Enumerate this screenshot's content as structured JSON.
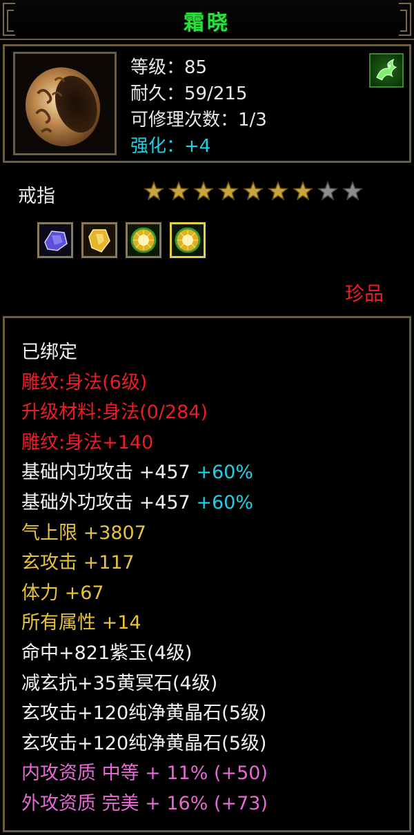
{
  "title": "霜晓",
  "header": {
    "level": "等级：85",
    "durability": "耐久：59/215",
    "repair": "可修理次数：1/3",
    "enhance": "强化：+4",
    "item_icon": "ring-icon",
    "badge_icon": "green-dragon-badge-icon"
  },
  "item_type": "戒指",
  "stars": {
    "filled": 7,
    "total": 9
  },
  "gems": [
    {
      "name": "purple-gem-icon",
      "color": "#5b4fd8",
      "selected": false
    },
    {
      "name": "yellow-crystal-gem-icon",
      "color": "#e6b52a",
      "selected": false
    },
    {
      "name": "pure-yellow-gem-icon",
      "color": "#e0b020",
      "selected": false
    },
    {
      "name": "pure-yellow-gem-icon",
      "color": "#e0b020",
      "selected": true
    }
  ],
  "rarity": "珍品",
  "attributes": [
    {
      "text": "已绑定",
      "color": "white"
    },
    {
      "text": "雕纹:身法(6级)",
      "color": "red"
    },
    {
      "text": "升级材料:身法(0/284)",
      "color": "red"
    },
    {
      "text": "雕纹:身法+140",
      "color": "red"
    },
    {
      "text": "基础内功攻击 +457",
      "color": "white",
      "suffix": " +60%"
    },
    {
      "text": "基础外功攻击 +457",
      "color": "white",
      "suffix": " +60%"
    },
    {
      "text": "气上限 +3807",
      "color": "yellow"
    },
    {
      "text": "玄攻击 +117",
      "color": "yellow"
    },
    {
      "text": "体力 +67",
      "color": "yellow"
    },
    {
      "text": "所有属性 +14",
      "color": "yellow"
    },
    {
      "text": "命中+821紫玉(4级)",
      "color": "white"
    },
    {
      "text": "减玄抗+35黄冥石(4级)",
      "color": "white"
    },
    {
      "text": "玄攻击+120纯净黄晶石(5级)",
      "color": "white"
    },
    {
      "text": "玄攻击+120纯净黄晶石(5级)",
      "color": "white"
    },
    {
      "text": "内攻资质 中等 + 11% (+50)",
      "color": "pink"
    },
    {
      "text": "外攻资质 完美 + 16% (+73)",
      "color": "pink"
    }
  ]
}
